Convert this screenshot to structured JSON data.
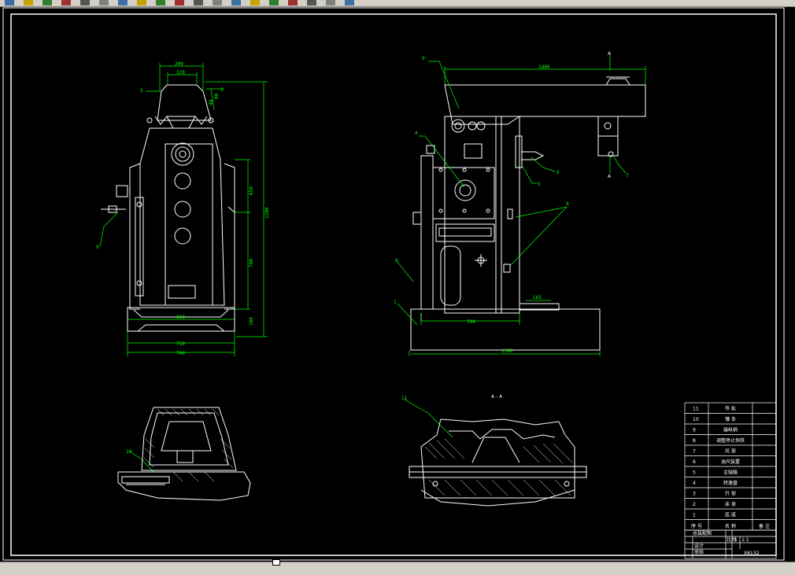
{
  "toolbar": {
    "layer_name": "0",
    "icons": [
      "new-icon",
      "open-icon",
      "save-icon",
      "print-icon",
      "cut-icon",
      "copy-icon",
      "paste-icon",
      "undo-icon",
      "redo-icon",
      "pan-icon",
      "zoom-realtime-icon",
      "zoom-window-icon",
      "zoom-previous-icon",
      "properties-icon",
      "text-icon",
      "table-icon",
      "layer-icon",
      "layer-state-icon",
      "color-icon"
    ]
  },
  "drawing": {
    "front_view": {
      "dims": {
        "top_w": "200",
        "top_w2": "320",
        "side_80": "80",
        "side_40": "40",
        "left5": "5",
        "right5": "5",
        "h_total": "1280",
        "h_650": "650",
        "h_700": "700",
        "h_180": "180",
        "base_650": "650",
        "base_750": "750",
        "base_700": "700"
      },
      "callouts": {
        "part9": "9"
      }
    },
    "side_view": {
      "dims": {
        "top_len": "1400",
        "base_len": "1380",
        "col_w": "790",
        "c65": "C65"
      },
      "section_mark_top": "A",
      "section_mark_bottom": "A",
      "callouts": {
        "part9": "9",
        "part4": "4",
        "part6": "6",
        "part7": "7",
        "part5": "5",
        "part8": "8",
        "part1": "1",
        "part9b": "9"
      }
    },
    "section_view": {
      "title": "A - A",
      "callouts": {
        "part11": "11",
        "part10": "10"
      }
    }
  },
  "title_block": {
    "rows": [
      {
        "no": "11",
        "name": "导 轨"
      },
      {
        "no": "10",
        "name": "镶 条"
      },
      {
        "no": "9",
        "name": "操纵柄"
      },
      {
        "no": "8",
        "name": "调整停止挡铁"
      },
      {
        "no": "7",
        "name": "托 架"
      },
      {
        "no": "6",
        "name": "油尺装置"
      },
      {
        "no": "5",
        "name": "主轴箱"
      },
      {
        "no": "4",
        "name": "转速盘"
      },
      {
        "no": "3",
        "name": "升 架"
      },
      {
        "no": "2",
        "name": "床 身"
      },
      {
        "no": "1",
        "name": "底 座"
      }
    ],
    "header": {
      "no": "序 号",
      "name": "名 称",
      "remark": "备 注"
    },
    "bottom": {
      "drawing_title": "总装配图",
      "scale_label": "比例",
      "scale_value": "1",
      "sheet": "1:1",
      "designer": "设计",
      "checker": "审核",
      "code": "X6132"
    }
  }
}
